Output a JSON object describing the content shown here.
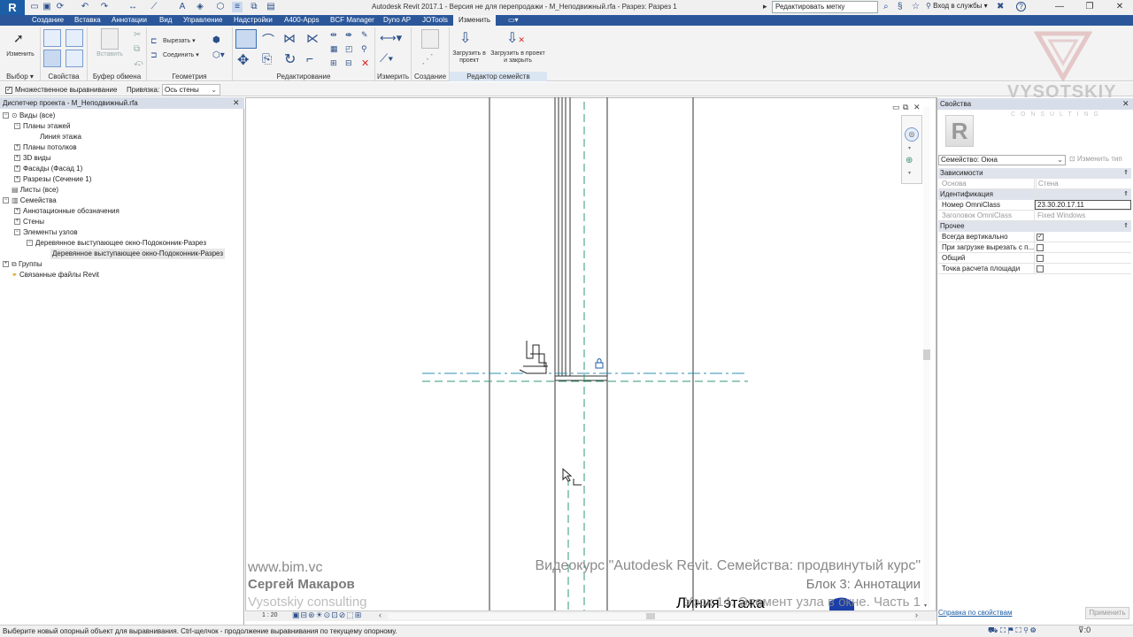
{
  "titlebar": {
    "app_letter": "R",
    "title": "Autodesk Revit 2017.1 - Версия не для перепродажи -    M_Неподвижный.rfa - Разрез: Разрез 1",
    "search_value": "Редактировать метку",
    "login": "Вход в службы",
    "help": "?"
  },
  "tabs": [
    "Создание",
    "Вставка",
    "Аннотации",
    "Вид",
    "Управление",
    "Надстройки",
    "А400-Apps",
    "BCF Manager",
    "Dyno AP",
    "JOTools",
    "Изменить"
  ],
  "ribbon": {
    "modify_label": "Изменить",
    "paste_label": "Вставить",
    "cut_label": "Вырезать",
    "join_label": "Соединить",
    "load_project_label": "Загрузить в проект",
    "load_close_label": "Загрузить в проект и закрыть",
    "panels": {
      "select": "Выбор",
      "properties": "Свойства",
      "clipboard": "Буфер обмена",
      "geometry": "Геометрия",
      "modify": "Редактирование",
      "measure": "Измерить",
      "create": "Создание",
      "family_editor": "Редактор семейств"
    }
  },
  "options_bar": {
    "multi_align_label": "Множественное выравнивание",
    "snap_label": "Привязка:",
    "snap_value": "Ось стены"
  },
  "project_browser": {
    "title": "Диспетчер проекта - M_Неподвижный.rfa",
    "items": [
      {
        "label": "Виды (все)"
      },
      {
        "label": "Планы этажей"
      },
      {
        "label": "Линия этажа"
      },
      {
        "label": "Планы потолков"
      },
      {
        "label": "3D виды"
      },
      {
        "label": "Фасады (Фасад 1)"
      },
      {
        "label": "Разрезы (Сечение 1)"
      },
      {
        "label": "Листы (все)"
      },
      {
        "label": "Семейства"
      },
      {
        "label": "Аннотационные обозначения"
      },
      {
        "label": "Стены"
      },
      {
        "label": "Элементы узлов"
      },
      {
        "label": "Деревянное выступающее окно-Подоконник-Разрез"
      },
      {
        "label": "Деревянное выступающее окно-Подоконник-Разрез"
      },
      {
        "label": "Группы"
      },
      {
        "label": "Связанные файлы Revit"
      }
    ]
  },
  "canvas": {
    "level_text": "Линия этажа",
    "scale": "1 : 20"
  },
  "watermark": {
    "site": "www.bim.vc",
    "author": "Сергей Макаров",
    "company": "Vysotskiy consulting",
    "course": "Видеокурс \"Autodesk Revit. Семейства: продвинутый курс\"",
    "block": "Блок 3: Аннотации",
    "lesson": "Урок 14: Элемент узла в окне. Часть 1",
    "logo_top": "VYSOTSKIY",
    "logo_bottom": "C O N S U L T I N G"
  },
  "properties": {
    "title": "Свойства",
    "type_selector": "Семейство: Окна",
    "edit_type": "Изменить тип",
    "groups": {
      "constraints": "Зависимости",
      "identity": "Идентификация",
      "other": "Прочее"
    },
    "rows": {
      "host_name": "Основа",
      "host_value": "Стена",
      "omniclass_num_name": "Номер OmniClass",
      "omniclass_num_value": "23.30.20.17.11",
      "omniclass_title_name": "Заголовок OmniClass",
      "omniclass_title_value": "Fixed Windows",
      "always_vertical": "Всегда вертикально",
      "cut_on_load": "При загрузке вырезать с п...",
      "shared": "Общий",
      "room_calc": "Точка расчета площади"
    },
    "help_link": "Справка по свойствам",
    "apply": "Применить"
  },
  "statusbar": {
    "message": "Выберите новый опорный объект для выравнивания. Ctrl-щелчок - продолжение выравнивания по текущему опорному.",
    "filter_count": ":0"
  },
  "colors": {
    "tab_bar": "#2b579a",
    "accent_blue": "#1d5fa6",
    "reference_line": "#2f9a6e"
  }
}
